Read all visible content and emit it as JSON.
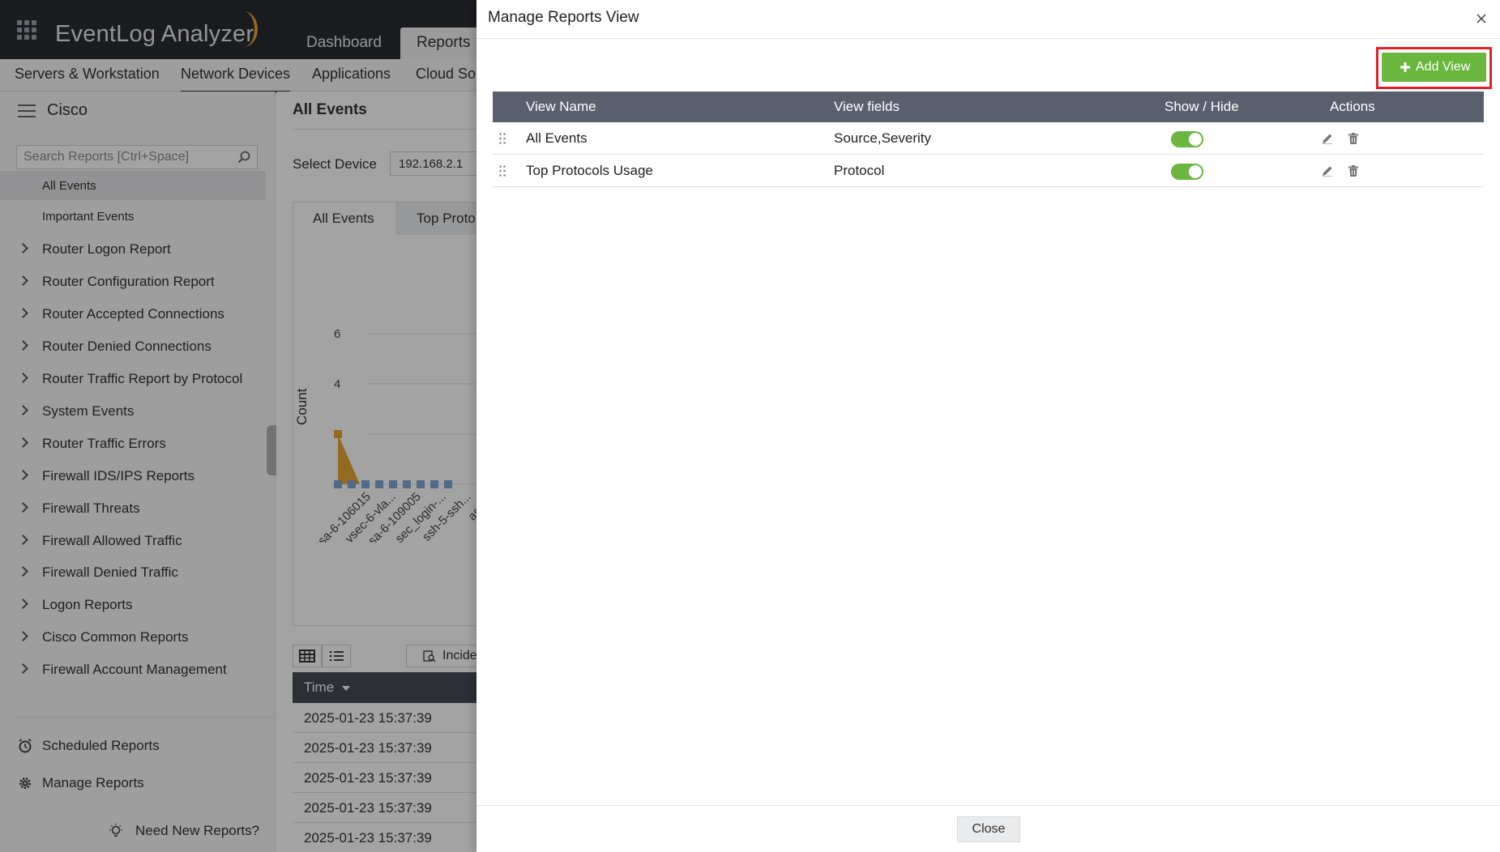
{
  "app": {
    "brand": "EventLog Analyzer",
    "top_nav": [
      "Dashboard",
      "Reports"
    ],
    "sub_nav": [
      "Servers & Workstation",
      "Network Devices",
      "Applications",
      "Cloud Sou"
    ]
  },
  "sidebar": {
    "title": "Cisco",
    "search_placeholder": "Search Reports [Ctrl+Space]",
    "sub_items": [
      "All Events",
      "Important Events"
    ],
    "groups": [
      "Router Logon Report",
      "Router Configuration Report",
      "Router Accepted Connections",
      "Router Denied Connections",
      "Router Traffic Report by Protocol",
      "System Events",
      "Router Traffic Errors",
      "Firewall IDS/IPS Reports",
      "Firewall Threats",
      "Firewall Allowed Traffic",
      "Firewall Denied Traffic",
      "Logon Reports",
      "Cisco Common Reports",
      "Firewall Account Management"
    ],
    "scheduled_reports": "Scheduled Reports",
    "manage_reports": "Manage Reports",
    "need_new_reports": "Need New Reports?"
  },
  "main": {
    "title": "All Events",
    "select_device_label": "Select Device",
    "select_device_value": "192.168.2.1",
    "tabs": [
      "All Events",
      "Top Proto"
    ],
    "incident_label": "Incident",
    "grid_header_time": "Time",
    "rows": [
      "2025-01-23 15:37:39",
      "2025-01-23 15:37:39",
      "2025-01-23 15:37:39",
      "2025-01-23 15:37:39",
      "2025-01-23 15:37:39"
    ]
  },
  "chart_data": {
    "type": "area",
    "ylabel": "Count",
    "ylim": [
      0,
      6
    ],
    "yticks": [
      "0",
      "2",
      "4",
      "6"
    ],
    "categories": [
      "asa-6-106015",
      "vsec-6-vla...",
      "asa-6-109005",
      "sec_login-...",
      "ssh-5-ssh...",
      "asa-..."
    ],
    "values": [
      2,
      0,
      0,
      0,
      0,
      0
    ],
    "color": "#e7a736",
    "marker_color": "#7fa7d6"
  },
  "modal": {
    "title": "Manage Reports View",
    "add_view_label": "Add View",
    "columns": [
      "View Name",
      "View fields",
      "Show / Hide",
      "Actions"
    ],
    "rows": [
      {
        "name": "All Events",
        "fields": "Source,Severity",
        "shown": true
      },
      {
        "name": "Top Protocols Usage",
        "fields": "Protocol",
        "shown": true
      }
    ],
    "close_label": "Close"
  },
  "colors": {
    "accent_green": "#6ab63e",
    "highlight_red": "#e0202a",
    "header_dark": "#2b2d33"
  }
}
